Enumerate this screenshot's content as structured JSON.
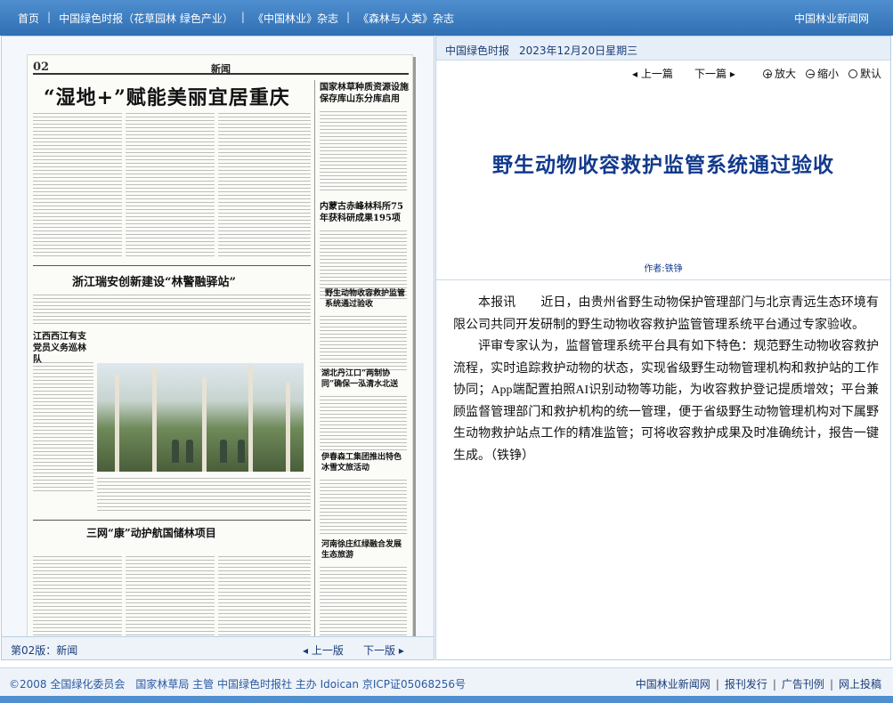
{
  "topbar": {
    "nav": [
      "首页",
      "中国绿色时报（花草园林 绿色产业）",
      "《中国林业》杂志",
      "《森林与人类》杂志"
    ],
    "site": "中国林业新闻网"
  },
  "newspaper_page": {
    "page_number": "02",
    "section": "新闻",
    "main_headline": "“湿地+”赋能美丽宜居重庆",
    "headlines": [
      "国家林草种质资源设施保存库山东分库启用",
      "内蒙古赤峰林科所75年获科研成果195项",
      "浙江瑞安创新建设“林警融驿站”",
      "野生动物收容救护监管系统通过验收",
      "江西西江有支党员义务巡林队",
      "湖北丹江口“两制协同”确保一泓清水北送",
      "伊春森工集团推出特色冰雪文旅活动",
      "三网“康”动护航国储林项目",
      "河南徐庄红绿融合发展生态旅游"
    ]
  },
  "left_footer": {
    "page_label": "第02版：新闻",
    "prev": "上一版",
    "next": "下一版"
  },
  "article_header": {
    "paper_name": "中国绿色时报",
    "date": "2023年12月20日星期三"
  },
  "tools": {
    "prev": "上一篇",
    "next": "下一篇",
    "zoom_in": "放大",
    "zoom_out": "缩小",
    "default": "默认"
  },
  "article": {
    "title": "野生动物收容救护监管系统通过验收",
    "author": "作者:铁铮",
    "paragraphs": [
      "本报讯　　近日，由贵州省野生动物保护管理部门与北京青远生态环境有限公司共同开发研制的野生动物收容救护监管管理系统平台通过专家验收。",
      "评审专家认为，监督管理系统平台具有如下特色：规范野生动物收容救护流程，实时追踪救护动物的状态，实现省级野生动物管理机构和救护站的工作协同；App端配置拍照AI识别动物等功能，为收容救护登记提质增效；平台兼顾监督管理部门和救护机构的统一管理，便于省级野生动物管理机构对下属野生动物救护站点工作的精准监管；可将收容救护成果及时准确统计，报告一键生成。（铁铮）"
    ]
  },
  "footer": {
    "copyright": "©2008 全国绿化委员会　国家林草局 主管 中国绿色时报社 主办 Idoican 京ICP证05068256号",
    "links": [
      "中国林业新闻网",
      "报刊发行",
      "广告刊例",
      "网上投稿"
    ]
  }
}
